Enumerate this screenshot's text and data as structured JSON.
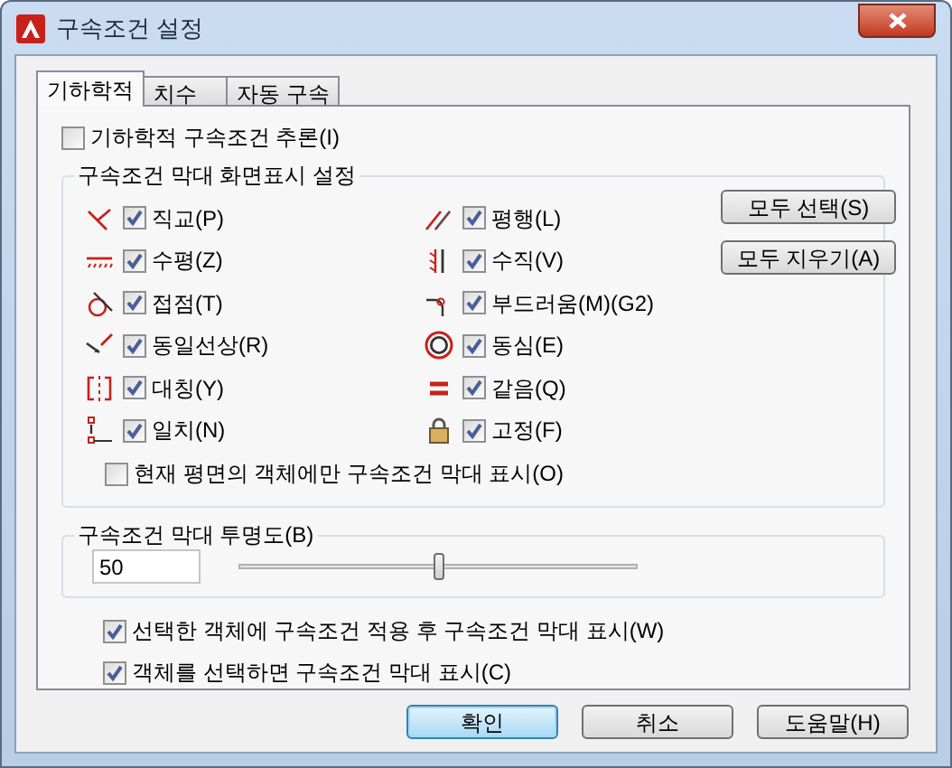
{
  "window": {
    "title": "구속조건 설정"
  },
  "tabs": [
    {
      "label": "기하학적",
      "selected": true
    },
    {
      "label": "치수",
      "selected": false
    },
    {
      "label": "자동 구속",
      "selected": false
    }
  ],
  "infer": {
    "label": "기하학적 구속조건 추론(I)",
    "checked": false
  },
  "display_group": {
    "title": "구속조건 막대 화면표시 설정",
    "constraints": [
      {
        "kind": "perpendicular",
        "label": "직교(P)",
        "checked": true
      },
      {
        "kind": "parallel",
        "label": "평행(L)",
        "checked": true
      },
      {
        "kind": "horizontal",
        "label": "수평(Z)",
        "checked": true
      },
      {
        "kind": "vertical",
        "label": "수직(V)",
        "checked": true
      },
      {
        "kind": "tangent",
        "label": "접점(T)",
        "checked": true
      },
      {
        "kind": "smooth",
        "label": "부드러움(M)(G2)",
        "checked": true
      },
      {
        "kind": "collinear",
        "label": "동일선상(R)",
        "checked": true
      },
      {
        "kind": "concentric",
        "label": "동심(E)",
        "checked": true
      },
      {
        "kind": "symmetric",
        "label": "대칭(Y)",
        "checked": true
      },
      {
        "kind": "equal",
        "label": "같음(Q)",
        "checked": true
      },
      {
        "kind": "coincident",
        "label": "일치(N)",
        "checked": true
      },
      {
        "kind": "fix",
        "label": "고정(F)",
        "checked": true
      }
    ],
    "buttons": [
      "모두 선택(S)",
      "모두 지우기(A)"
    ],
    "current_plane_only": {
      "label": "현재 평면의 객체에만 구속조건 막대 표시(O)",
      "checked": false
    }
  },
  "transparency_group": {
    "title": "구속조건 막대 투명도(B)",
    "value": "50",
    "level": 0.5
  },
  "options": [
    {
      "label": "선택한 객체에 구속조건 적용 후 구속조건 막대 표시(W)",
      "checked": true
    },
    {
      "label": "객체를 선택하면 구속조건 막대 표시(C)",
      "checked": true
    }
  ],
  "buttons": [
    {
      "label": "확인",
      "default": true
    },
    {
      "label": "취소",
      "default": false
    },
    {
      "label": "도움말(H)",
      "default": false
    }
  ]
}
